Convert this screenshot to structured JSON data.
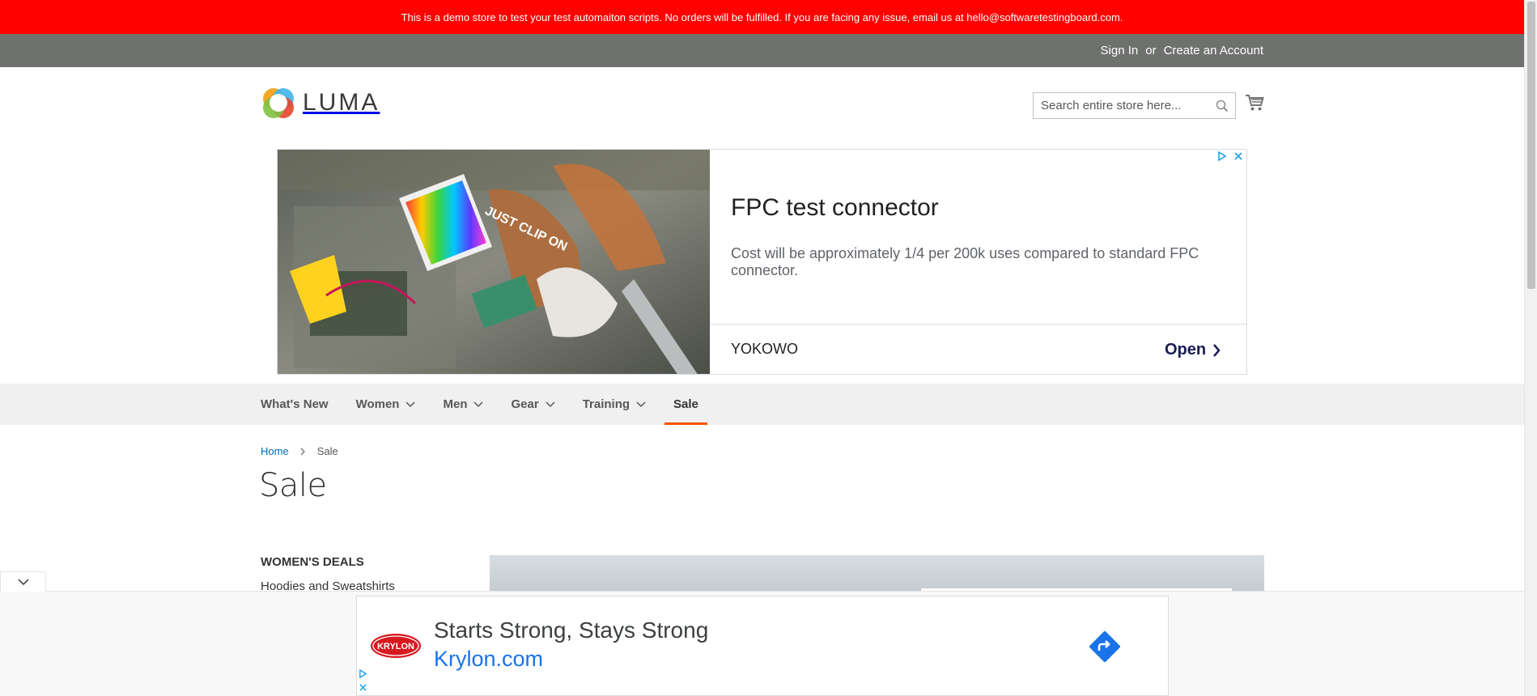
{
  "notice": {
    "text": "This is a demo store to test your test automaiton scripts. No orders will be fulfilled. If you are facing any issue, email us at hello@softwaretestingboard.com."
  },
  "panel": {
    "sign_in": "Sign In",
    "or": "or",
    "create_account": "Create an Account"
  },
  "header": {
    "logo_text": "LUMA",
    "search_placeholder": "Search entire store here...",
    "search_value": "",
    "cart_icon": "cart-icon",
    "search_icon": "search-icon"
  },
  "ad_top": {
    "image_text": "JUST CLIP ON",
    "title": "FPC test connector",
    "description": "Cost will be approximately 1/4 per 200k uses compared to standard FPC connector.",
    "advertiser": "YOKOWO",
    "cta": "Open"
  },
  "nav": {
    "items": [
      {
        "label": "What's New",
        "dropdown": false
      },
      {
        "label": "Women",
        "dropdown": true
      },
      {
        "label": "Men",
        "dropdown": true
      },
      {
        "label": "Gear",
        "dropdown": true
      },
      {
        "label": "Training",
        "dropdown": true
      },
      {
        "label": "Sale",
        "dropdown": false,
        "active": true
      }
    ],
    "active_color": "#ff5501"
  },
  "breadcrumbs": {
    "home": "Home",
    "current": "Sale"
  },
  "page": {
    "title": "Sale"
  },
  "sidebar": {
    "title": "Women's Deals",
    "link": "Hoodies and Sweatshirts"
  },
  "bottom_ad": {
    "brand_logo": "KRYLON",
    "headline": "Starts Strong, Stays Strong",
    "url": "Krylon.com"
  },
  "colors": {
    "notice_bg": "#ff0101",
    "panel_bg": "#6e716e",
    "nav_bg": "#f0f0f0",
    "link": "#006bb4"
  }
}
